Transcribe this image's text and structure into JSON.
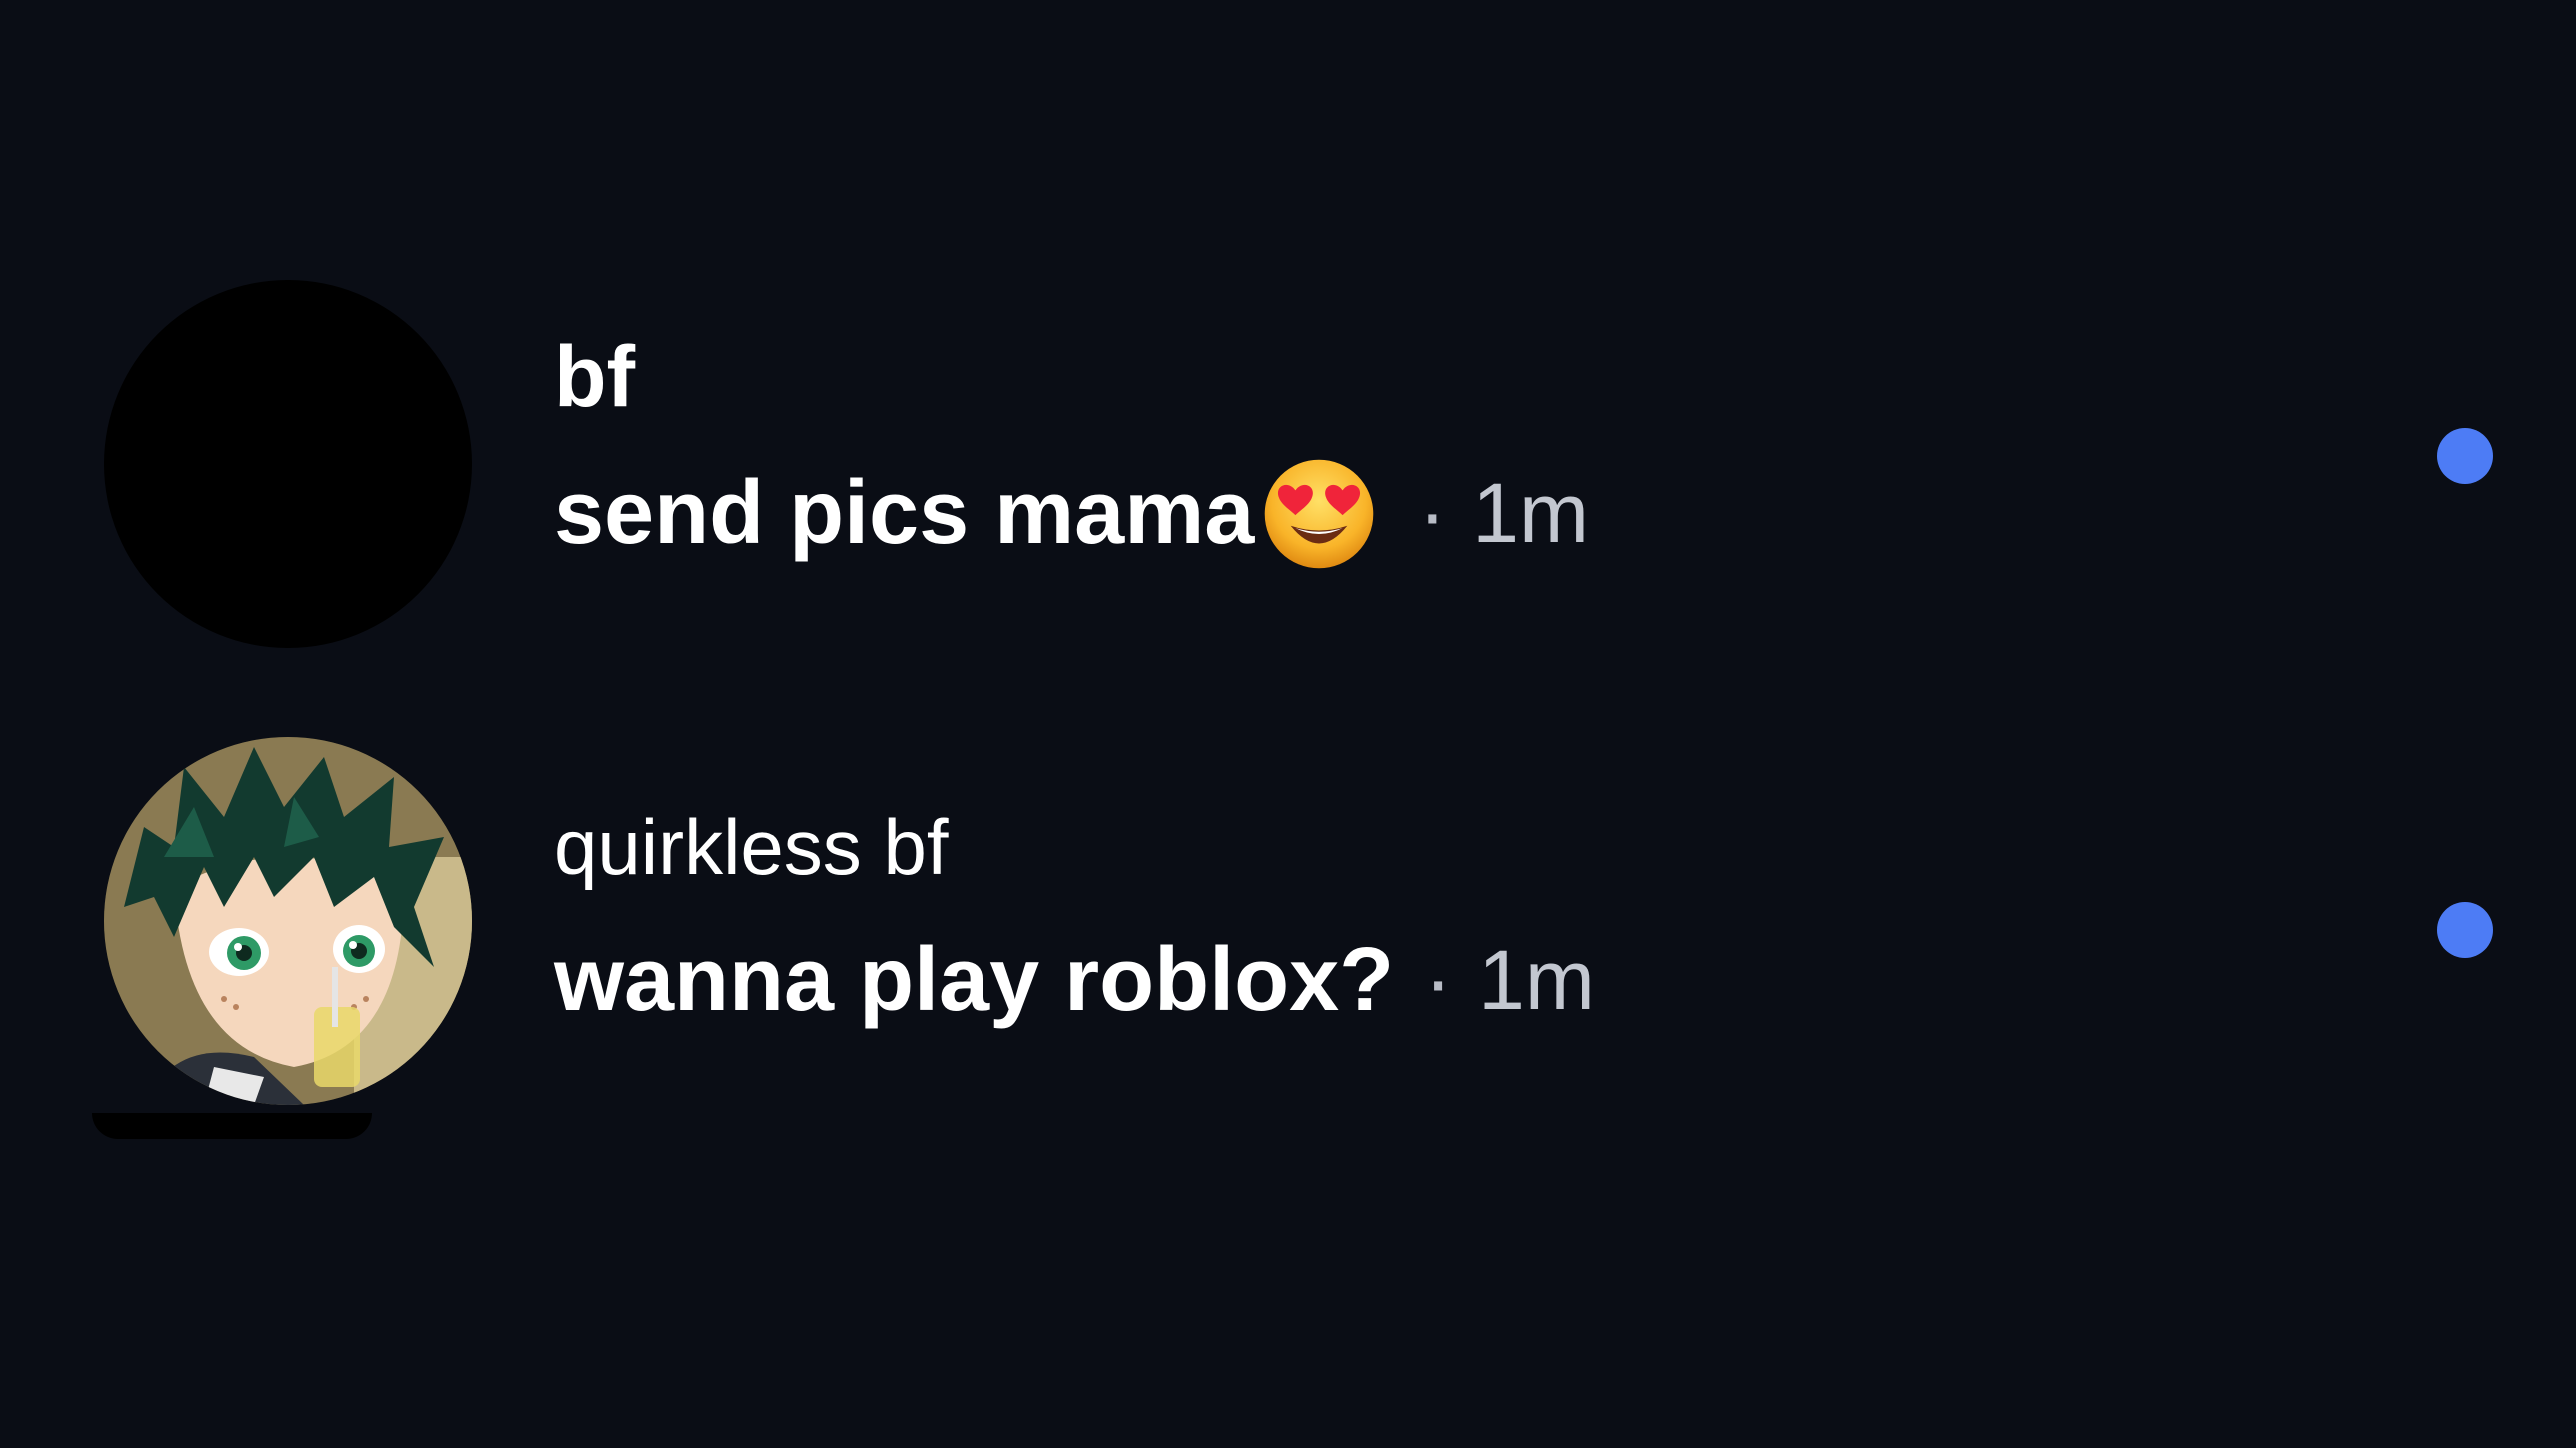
{
  "threads": [
    {
      "name": "bf",
      "message": "send pics mama",
      "emoji": "heart-eyes-emoji",
      "separator": "·",
      "time": "1m",
      "unread": true,
      "avatar": "blank-black-avatar"
    },
    {
      "name": "quirkless bf",
      "message": "wanna play roblox?",
      "separator": "·",
      "time": "1m",
      "unread": true,
      "avatar": "anime-character-avatar"
    }
  ],
  "colors": {
    "background": "#0a0d15",
    "primary_text": "#ffffff",
    "secondary_text": "#c3c7d0",
    "unread_dot": "#4d7cf5"
  }
}
